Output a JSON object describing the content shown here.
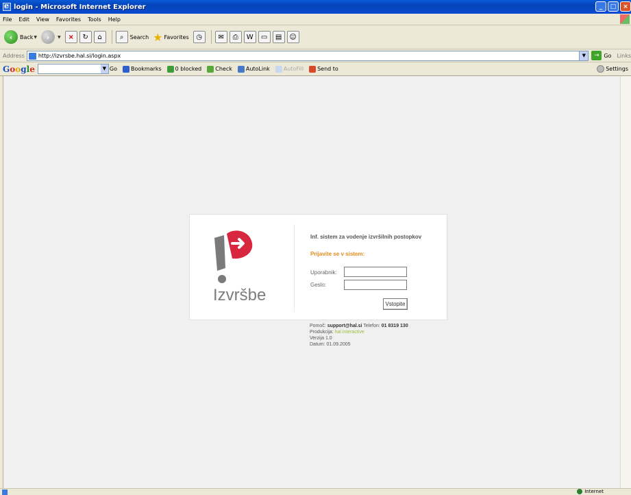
{
  "window": {
    "title": "login - Microsoft Internet Explorer"
  },
  "menu": {
    "items": [
      "File",
      "Edit",
      "View",
      "Favorites",
      "Tools",
      "Help"
    ]
  },
  "toolbar": {
    "back_label": "Back",
    "search_label": "Search",
    "favorites_label": "Favorites"
  },
  "address": {
    "label": "Address",
    "url": "http://izvrsbe.hal.si/login.aspx",
    "go_label": "Go",
    "links_label": "Links"
  },
  "google_bar": {
    "go_label": "Go",
    "bookmarks_label": "Bookmarks",
    "blocked_label": "0 blocked",
    "check_label": "Check",
    "autolink_label": "AutoLink",
    "autofill_label": "AutoFill",
    "sendto_label": "Send to",
    "settings_label": "Settings"
  },
  "login": {
    "logo_text": "Izvršbe",
    "system_title": "Inf. sistem za vodenje izvršilnih postopkov",
    "prompt": "Prijavite se v sistem:",
    "username_label": "Uporabnik:",
    "password_label": "Geslo:",
    "username_value": "",
    "password_value": "",
    "submit_label": "Vstopite"
  },
  "footer": {
    "help_label": "Pomoč:",
    "help_email": "support@hal.si",
    "phone_label": "Telefon:",
    "phone": "01 8319 130",
    "production_label": "Produkcija:",
    "production": "hal interactive",
    "version": "Verzija 1.0",
    "date": "Datum: 01.09.2005"
  },
  "statusbar": {
    "zone_label": "Internet"
  },
  "colors": {
    "accent_orange": "#e88c1c",
    "logo_red": "#d7263d",
    "logo_grey": "#7d7d7d",
    "producer_green": "#9bbd3a"
  }
}
